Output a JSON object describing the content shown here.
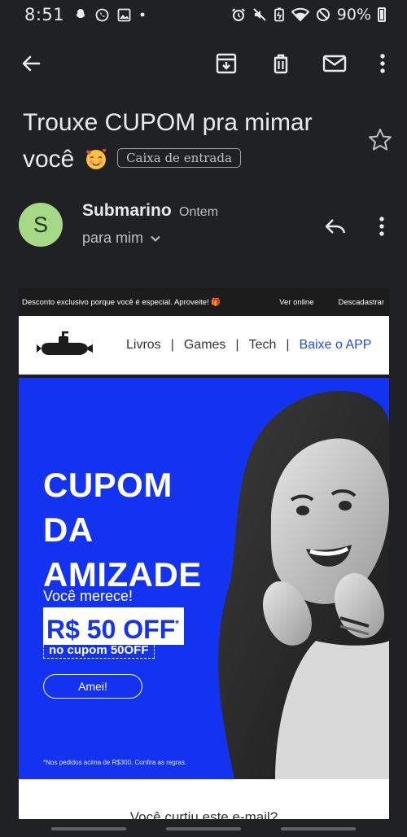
{
  "status_bar": {
    "time": "8:51",
    "left_icons": [
      "snapchat-icon",
      "whatsapp-icon",
      "gallery-icon",
      "dot-icon"
    ],
    "right_icons": [
      "alarm-icon",
      "mute-icon",
      "battery-saver-icon",
      "wifi-icon",
      "dnd-icon",
      "battery-icon"
    ],
    "battery": "90%"
  },
  "app_bar": {
    "actions": [
      "archive-icon",
      "delete-icon",
      "mark-unread-icon",
      "more-vert-icon"
    ]
  },
  "email": {
    "subject_line1": "Trouxe CUPOM pra mimar",
    "subject_line2": "você",
    "label": "Caixa de entrada",
    "sender": {
      "initial": "S",
      "name": "Submarino",
      "time": "Ontem",
      "to": "para mim",
      "avatar_color": "#a6d987"
    },
    "body": {
      "preheader": "Desconto exclusivo porque você é especial. Aproveite! 🎁",
      "view_online": "Ver online",
      "unsubscribe": "Descadastrar",
      "nav": {
        "livros": "Livros",
        "games": "Games",
        "tech": "Tech",
        "app": "Baixe o APP",
        "sep": "|"
      },
      "hero": {
        "line1": "CUPOM",
        "line2": "DA",
        "line3": "AMIZADE",
        "sub": "Você merece!",
        "price": "R$ 50 OFF",
        "price_mark": "*",
        "coupon": "no cupom 50OFF",
        "button": "Amei!",
        "footnote": "*Nos pedidos acima de R$300. Confira as regras."
      },
      "feedback": "Você curtiu este e-mail?"
    }
  },
  "colors": {
    "background": "#202124",
    "hero_blue": "#1433f0",
    "link_blue": "#1a4bff"
  }
}
